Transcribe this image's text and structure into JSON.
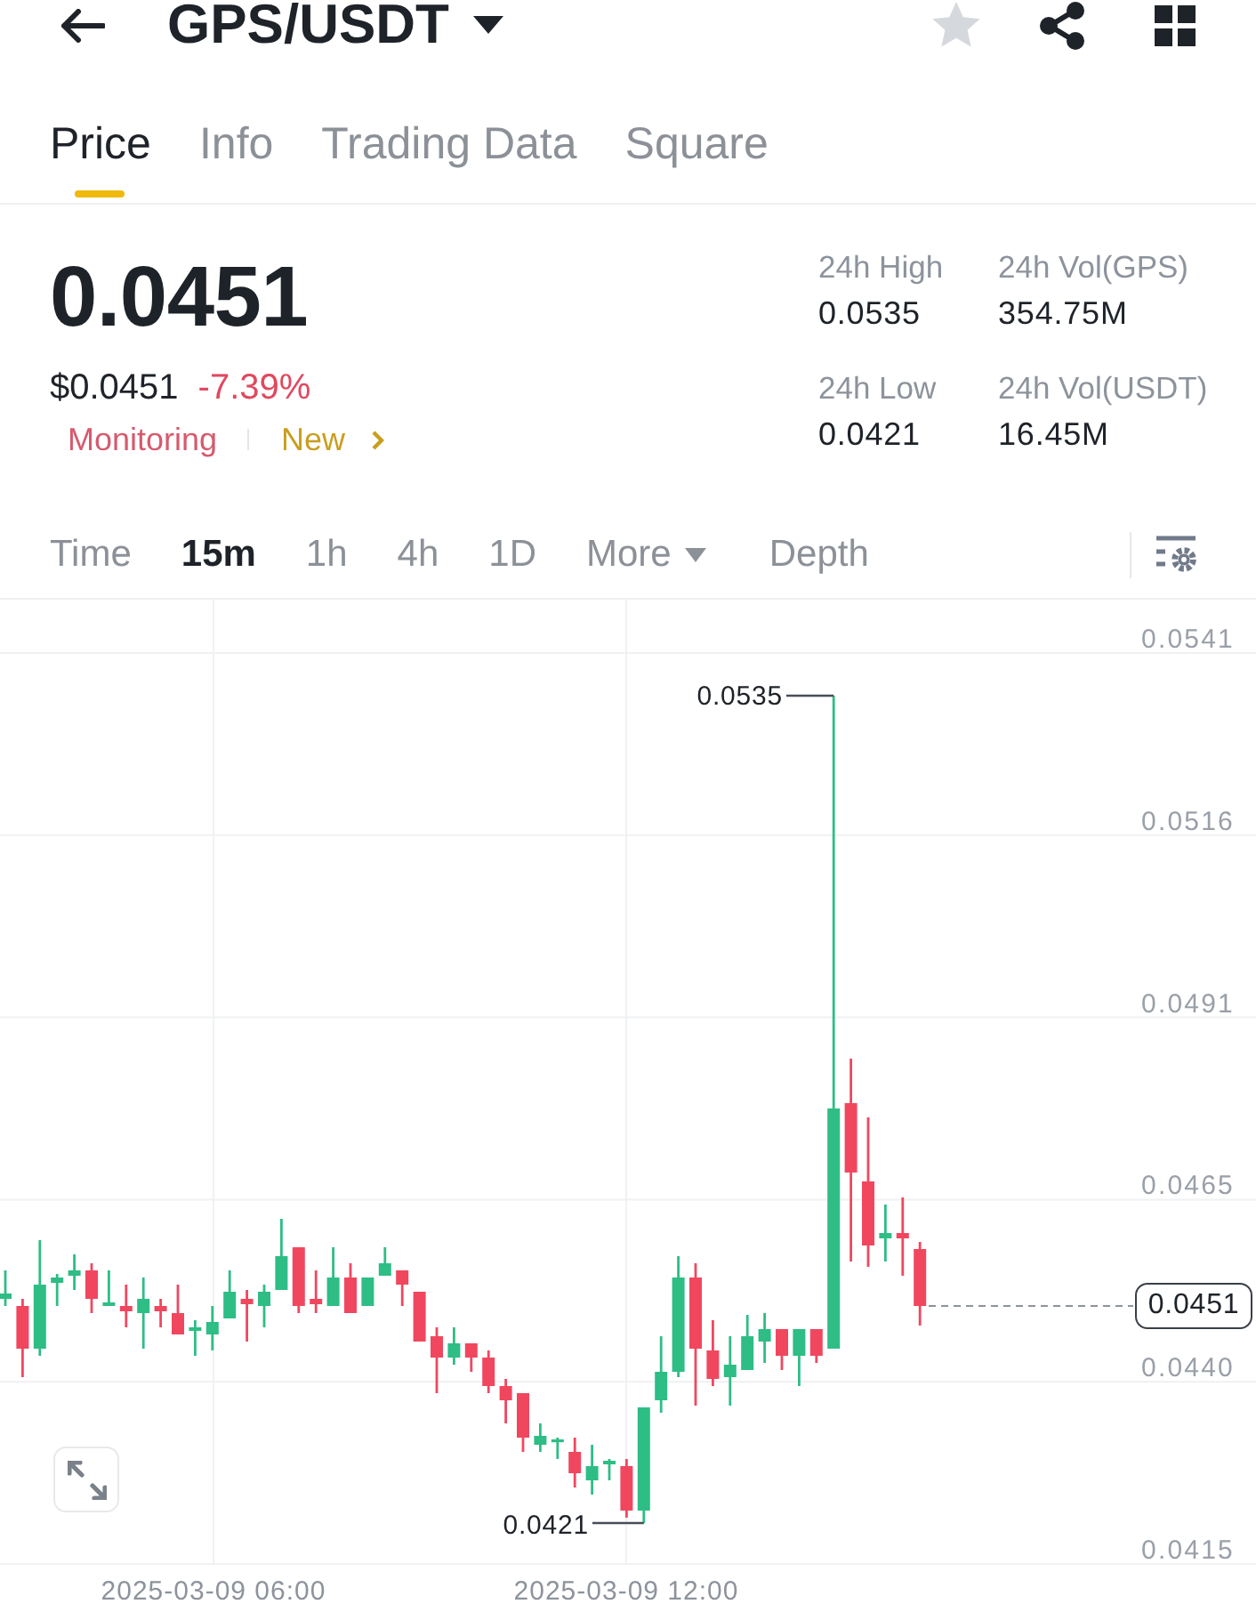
{
  "header": {
    "title": "GPS/USDT",
    "favorite": false
  },
  "tabs": [
    {
      "label": "Price",
      "selected": true
    },
    {
      "label": "Info",
      "selected": false
    },
    {
      "label": "Trading Data",
      "selected": false
    },
    {
      "label": "Square",
      "selected": false
    }
  ],
  "price": {
    "last": "0.0451",
    "usd": "$0.0451",
    "change": "-7.39%",
    "falling": true
  },
  "tags": [
    {
      "label": "Monitoring",
      "color": "#d65a6e"
    },
    {
      "label": "New",
      "color": "#c99e1f"
    }
  ],
  "stats": [
    {
      "label": "24h High",
      "value": "0.0535"
    },
    {
      "label": "24h Vol(GPS)",
      "value": "354.75M"
    },
    {
      "label": "24h Low",
      "value": "0.0421"
    },
    {
      "label": "24h Vol(USDT)",
      "value": "16.45M"
    }
  ],
  "intervals": [
    {
      "label": "Time",
      "selected": false,
      "kind": "tab"
    },
    {
      "label": "15m",
      "selected": true,
      "kind": "tab"
    },
    {
      "label": "1h",
      "selected": false,
      "kind": "tab"
    },
    {
      "label": "4h",
      "selected": false,
      "kind": "tab"
    },
    {
      "label": "1D",
      "selected": false,
      "kind": "tab"
    },
    {
      "label": "More",
      "selected": false,
      "kind": "dropdown"
    },
    {
      "label": "Depth",
      "selected": false,
      "kind": "tab"
    }
  ],
  "chart": {
    "price_labels": [
      "0.0541",
      "0.0516",
      "0.0491",
      "0.0465",
      "0.0440",
      "0.0415"
    ],
    "time_labels": [
      "2025-03-09 06:00",
      "2025-03-09 12:00"
    ],
    "high_marker": "0.0535",
    "low_marker": "0.0421",
    "last_price": "0.0451"
  }
}
